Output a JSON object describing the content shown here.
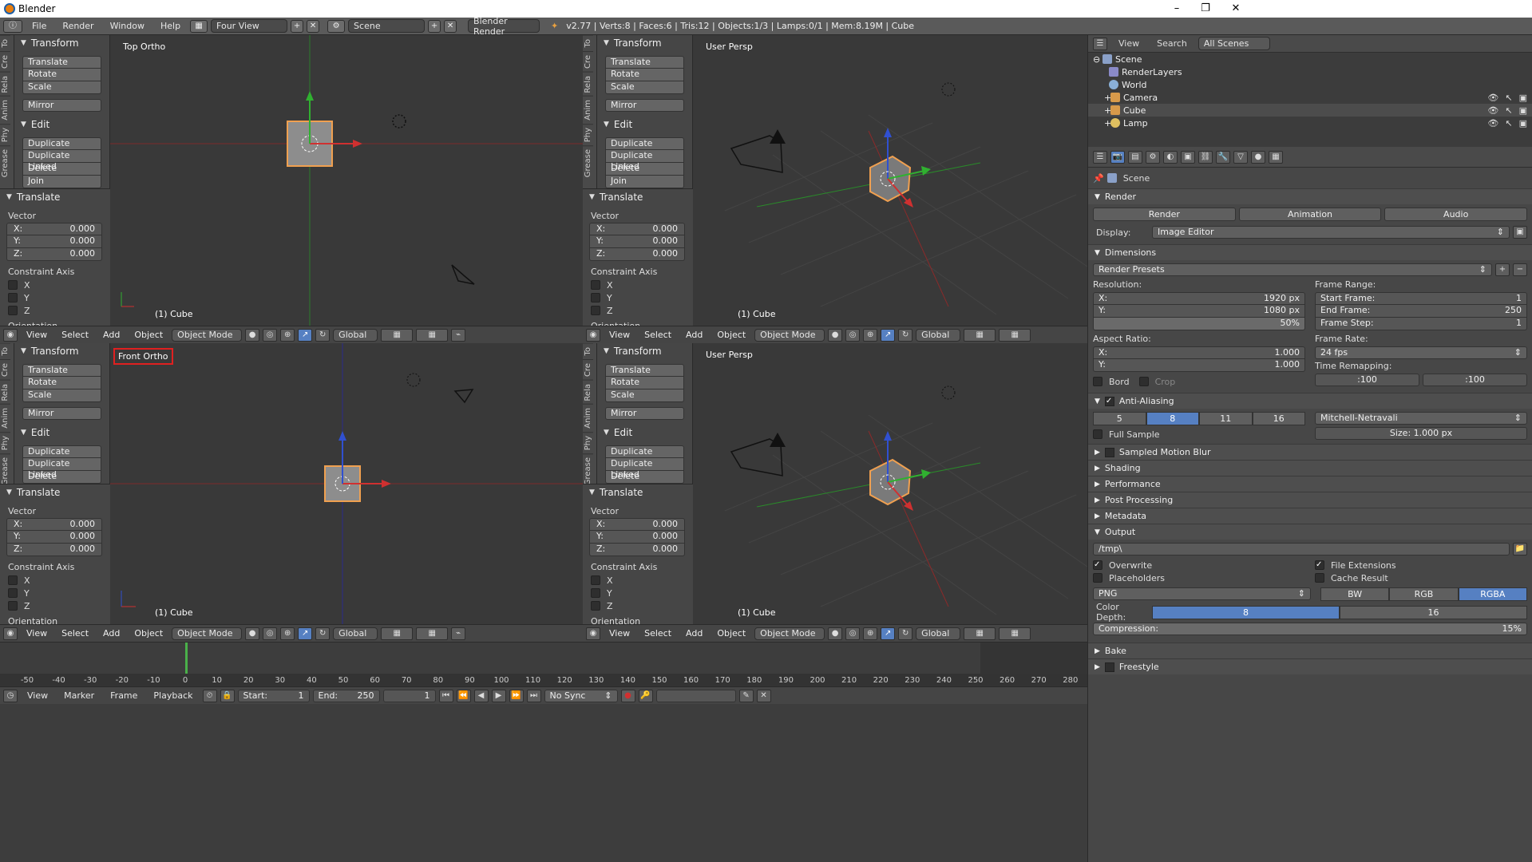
{
  "window": {
    "title": "Blender",
    "min": "–",
    "max": "❐",
    "close": "✕"
  },
  "topbar": {
    "menus": [
      "File",
      "Render",
      "Window",
      "Help"
    ],
    "layout": "Four View",
    "scene": "Scene",
    "engine": "Blender Render",
    "stats": "v2.77 | Verts:8 | Faces:6 | Tris:12 | Objects:1/3 | Lamps:0/1 | Mem:8.19M | Cube"
  },
  "toolshelf": {
    "tabs": [
      "To",
      "Cre",
      "Rela",
      "Anim",
      "Phy",
      "Grease"
    ],
    "transform_title": "Transform",
    "transform_buttons": [
      "Translate",
      "Rotate",
      "Scale"
    ],
    "mirror": "Mirror",
    "edit_title": "Edit",
    "edit_buttons": [
      "Duplicate",
      "Duplicate Linked",
      "Delete",
      "Join"
    ],
    "operator_title": "Translate",
    "vector_label": "Vector",
    "vector": [
      {
        "axis": "X:",
        "value": "0.000"
      },
      {
        "axis": "Y:",
        "value": "0.000"
      },
      {
        "axis": "Z:",
        "value": "0.000"
      }
    ],
    "constraint_label": "Constraint Axis",
    "constraints": [
      "X",
      "Y",
      "Z"
    ],
    "orientation": "Orientation"
  },
  "viewports": [
    {
      "label": "Top Ortho",
      "object": "(1) Cube"
    },
    {
      "label": "User Persp",
      "object": "(1) Cube"
    },
    {
      "label": "Front Ortho",
      "object": "(1) Cube"
    },
    {
      "label": "User Persp",
      "object": "(1) Cube"
    }
  ],
  "vpheader": {
    "menus": [
      "View",
      "Select",
      "Add",
      "Object"
    ],
    "mode": "Object Mode",
    "orientation": "Global"
  },
  "outliner": {
    "menus": [
      "View",
      "Search"
    ],
    "filter": "All Scenes",
    "rows": [
      {
        "name": "Scene",
        "color": "#8aa0c8"
      },
      {
        "name": "RenderLayers",
        "color": "#8a8ac8"
      },
      {
        "name": "World",
        "color": "#8ab0d8"
      },
      {
        "name": "Camera",
        "color": "#d89a4a"
      },
      {
        "name": "Cube",
        "color": "#d89a4a"
      },
      {
        "name": "Lamp",
        "color": "#e0c060"
      }
    ]
  },
  "properties": {
    "context": "Scene",
    "render_title": "Render",
    "render_buttons": [
      "Render",
      "Animation",
      "Audio"
    ],
    "display_label": "Display:",
    "display_value": "Image Editor",
    "dimensions_title": "Dimensions",
    "presets": "Render Presets",
    "resolution_label": "Resolution:",
    "res_x": "1920 px",
    "res_y": "1080 px",
    "res_pct": "50%",
    "frame_range_label": "Frame Range:",
    "start_frame": "1",
    "end_frame": "250",
    "frame_step": "1",
    "start_label": "Start Frame:",
    "end_label": "End Frame:",
    "step_label": "Frame Step:",
    "aspect_label": "Aspect Ratio:",
    "aspect_x": "1.000",
    "aspect_y": "1.000",
    "frame_rate_label": "Frame Rate:",
    "fps": "24 fps",
    "time_remap_label": "Time Remapping:",
    "remap_old": ":100",
    "remap_new": ":100",
    "bord": "Bord",
    "crop": "Crop",
    "aa_title": "Anti-Aliasing",
    "aa_samples": [
      "5",
      "8",
      "11",
      "16"
    ],
    "aa_filter": "Mitchell-Netravali",
    "full_sample": "Full Sample",
    "aa_size": "Size:  1.000 px",
    "sections": [
      "Sampled Motion Blur",
      "Shading",
      "Performance",
      "Post Processing",
      "Metadata"
    ],
    "output_title": "Output",
    "output_path": "/tmp\\",
    "overwrite": "Overwrite",
    "file_ext": "File Extensions",
    "placeholders": "Placeholders",
    "cache": "Cache Result",
    "format": "PNG",
    "color_modes": [
      "BW",
      "RGB",
      "RGBA"
    ],
    "color_depth_label": "Color Depth:",
    "depths": [
      "8",
      "16"
    ],
    "compression": "Compression:",
    "compression_value": "15%",
    "bake": "Bake",
    "freestyle": "Freestyle"
  },
  "timeline": {
    "ticks": [
      "-50",
      "-40",
      "-30",
      "-20",
      "-10",
      "0",
      "10",
      "20",
      "30",
      "40",
      "50",
      "60",
      "70",
      "80",
      "90",
      "100",
      "110",
      "120",
      "130",
      "140",
      "150",
      "160",
      "170",
      "180",
      "190",
      "200",
      "210",
      "220",
      "230",
      "240",
      "250",
      "260",
      "270",
      "280"
    ],
    "menus": [
      "View",
      "Marker",
      "Frame",
      "Playback"
    ],
    "start_label": "Start:",
    "start": "1",
    "end_label": "End:",
    "end": "250",
    "current": "1",
    "sync": "No Sync"
  },
  "colors": {
    "accent": "#5680c2",
    "x_axis": "#d03030",
    "y_axis": "#30b030",
    "z_axis": "#3050d0",
    "selection": "#f0a050",
    "highlight_box": "#e02020"
  }
}
